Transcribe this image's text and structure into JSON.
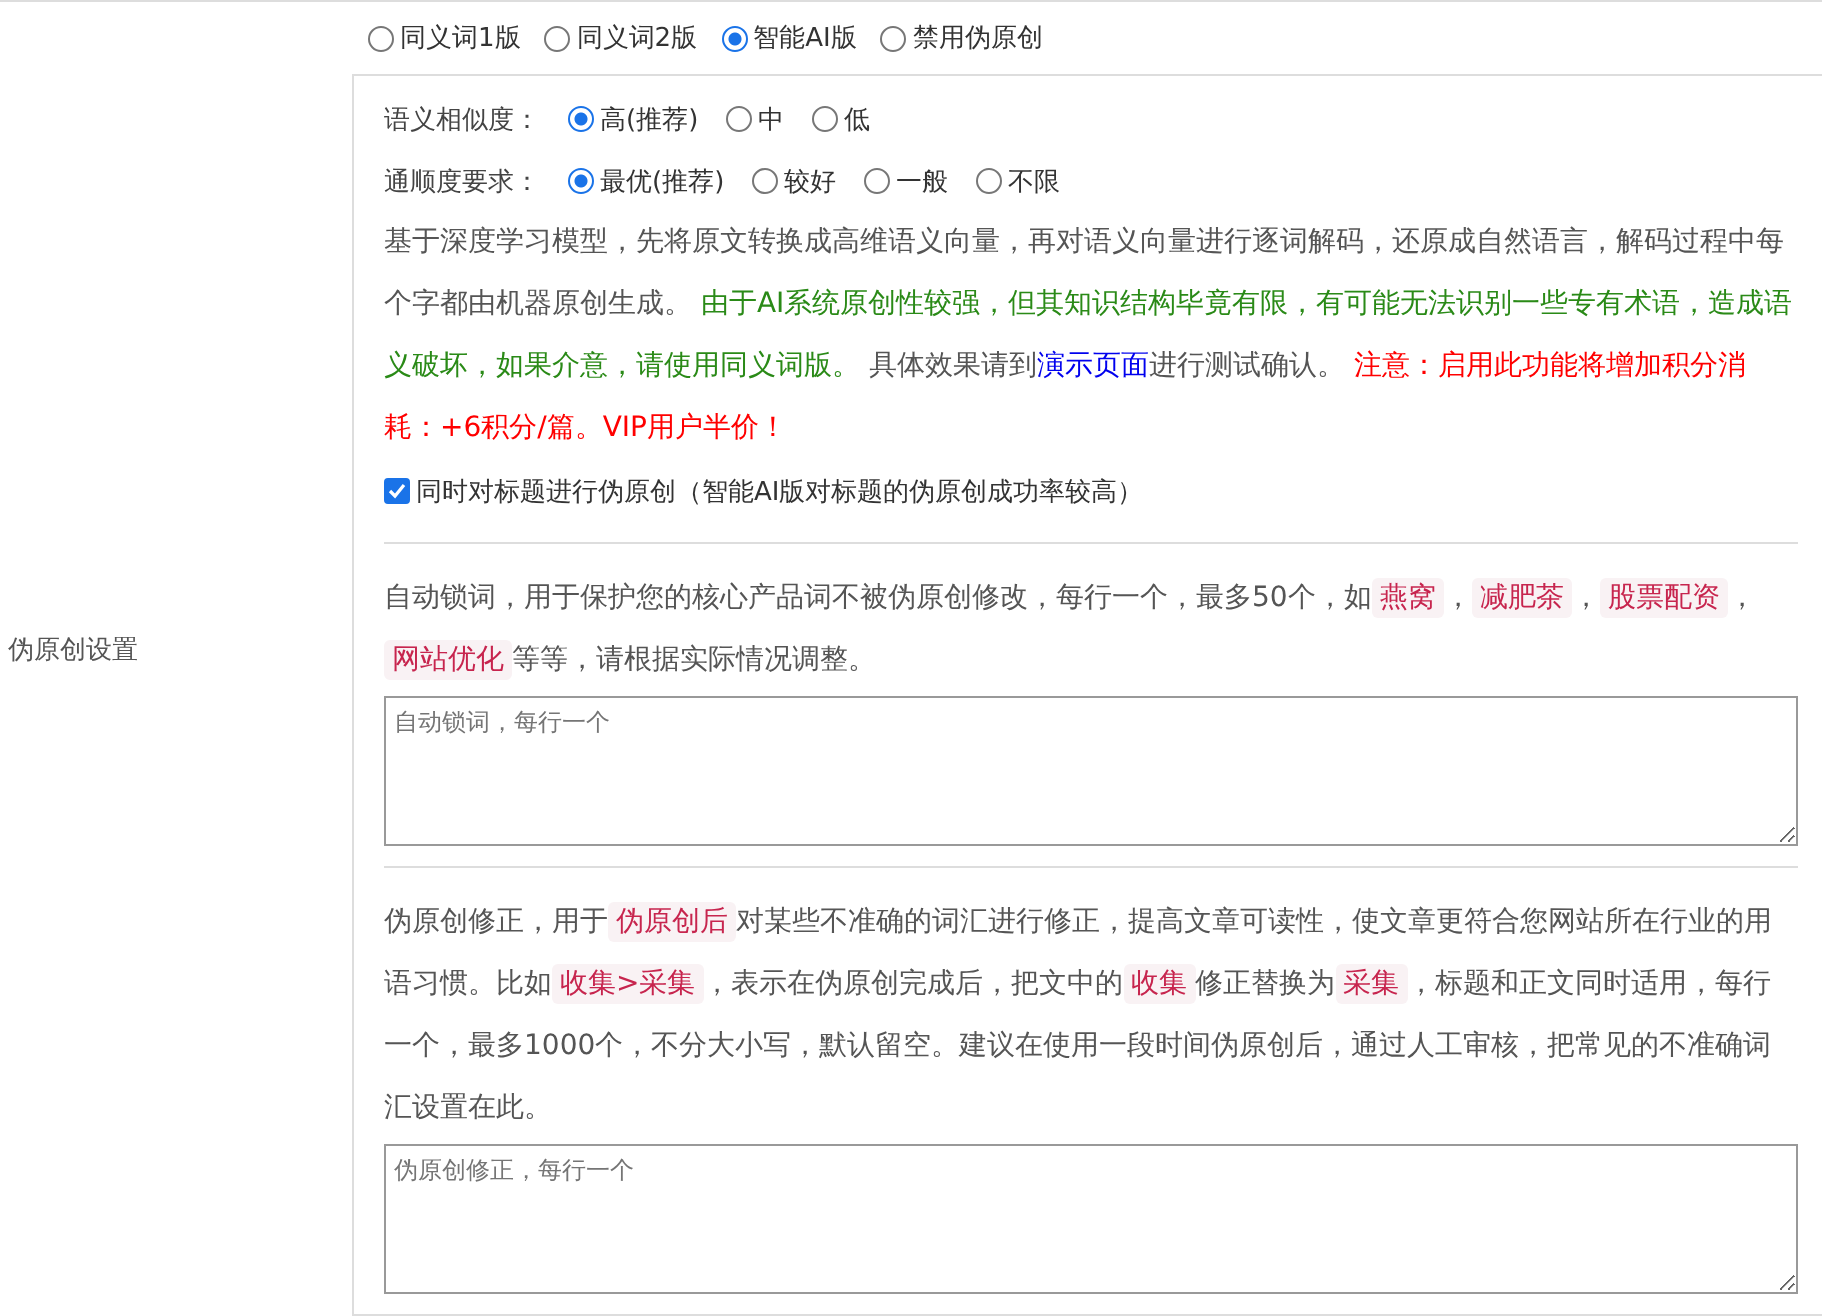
{
  "mode_options": [
    {
      "label": "同义词1版",
      "selected": false
    },
    {
      "label": "同义词2版",
      "selected": false
    },
    {
      "label": "智能AI版",
      "selected": true
    },
    {
      "label": "禁用伪原创",
      "selected": false
    }
  ],
  "settings": [
    {
      "label": "语义相似度：",
      "options": [
        {
          "label": "高(推荐)",
          "selected": true
        },
        {
          "label": "中",
          "selected": false
        },
        {
          "label": "低",
          "selected": false
        }
      ]
    },
    {
      "label": "通顺度要求：",
      "options": [
        {
          "label": "最优(推荐)",
          "selected": true
        },
        {
          "label": "较好",
          "selected": false
        },
        {
          "label": "一般",
          "selected": false
        },
        {
          "label": "不限",
          "selected": false
        }
      ]
    }
  ],
  "description": [
    {
      "kind": "text",
      "text": "基于深度学习模型，先将原文转换成高维语义向量，再对语义向量进行逐词解码，还原成自然语言，解码过程中每个字都由机器原创生成。 "
    },
    {
      "kind": "success",
      "text": "由于AI系统原创性较强，但其知识结构毕竟有限，有可能无法识别一些专有术语，造成语义破坏，如果介意，请使用同义词版。"
    },
    {
      "kind": "text",
      "text": " 具体效果请到"
    },
    {
      "kind": "link",
      "text": "演示页面"
    },
    {
      "kind": "text",
      "text": "进行测试确认。 "
    },
    {
      "kind": "warning",
      "text": "注意：启用此功能将增加积分消耗：+6积分/篇。VIP用户半价！"
    }
  ],
  "title_option": {
    "label": "同时对标题进行伪原创（智能AI版对标题的伪原创成功率较高）",
    "checked": true
  },
  "side_label": "伪原创设置",
  "lock_words": {
    "description": [
      {
        "kind": "text",
        "text": "自动锁词，用于保护您的核心产品词不被伪原创修改，每行一个，最多50个，如"
      },
      {
        "kind": "tag",
        "text": "燕窝"
      },
      {
        "kind": "text",
        "text": "，"
      },
      {
        "kind": "tag",
        "text": "减肥茶"
      },
      {
        "kind": "text",
        "text": "，"
      },
      {
        "kind": "tag",
        "text": "股票配资"
      },
      {
        "kind": "text",
        "text": "，"
      },
      {
        "kind": "tag",
        "text": "网站优化"
      },
      {
        "kind": "text",
        "text": "等等，请根据实际情况调整。"
      }
    ],
    "placeholder": "自动锁词，每行一个"
  },
  "corrections": {
    "description": [
      {
        "kind": "text",
        "text": "伪原创修正，用于"
      },
      {
        "kind": "tag",
        "text": "伪原创后"
      },
      {
        "kind": "text",
        "text": "对某些不准确的词汇进行修正，提高文章可读性，使文章更符合您网站所在行业的用语习惯。比如"
      },
      {
        "kind": "tag",
        "text": "收集>采集"
      },
      {
        "kind": "text",
        "text": "，表示在伪原创完成后，把文中的"
      },
      {
        "kind": "tag",
        "text": "收集"
      },
      {
        "kind": "text",
        "text": "修正替换为"
      },
      {
        "kind": "tag",
        "text": "采集"
      },
      {
        "kind": "text",
        "text": "，标题和正文同时适用，每行一个，最多1000个，不分大小写，默认留空。建议在使用一段时间伪原创后，通过人工审核，把常见的不准确词汇设置在此。"
      }
    ],
    "placeholder": "伪原创修正，每行一个"
  }
}
